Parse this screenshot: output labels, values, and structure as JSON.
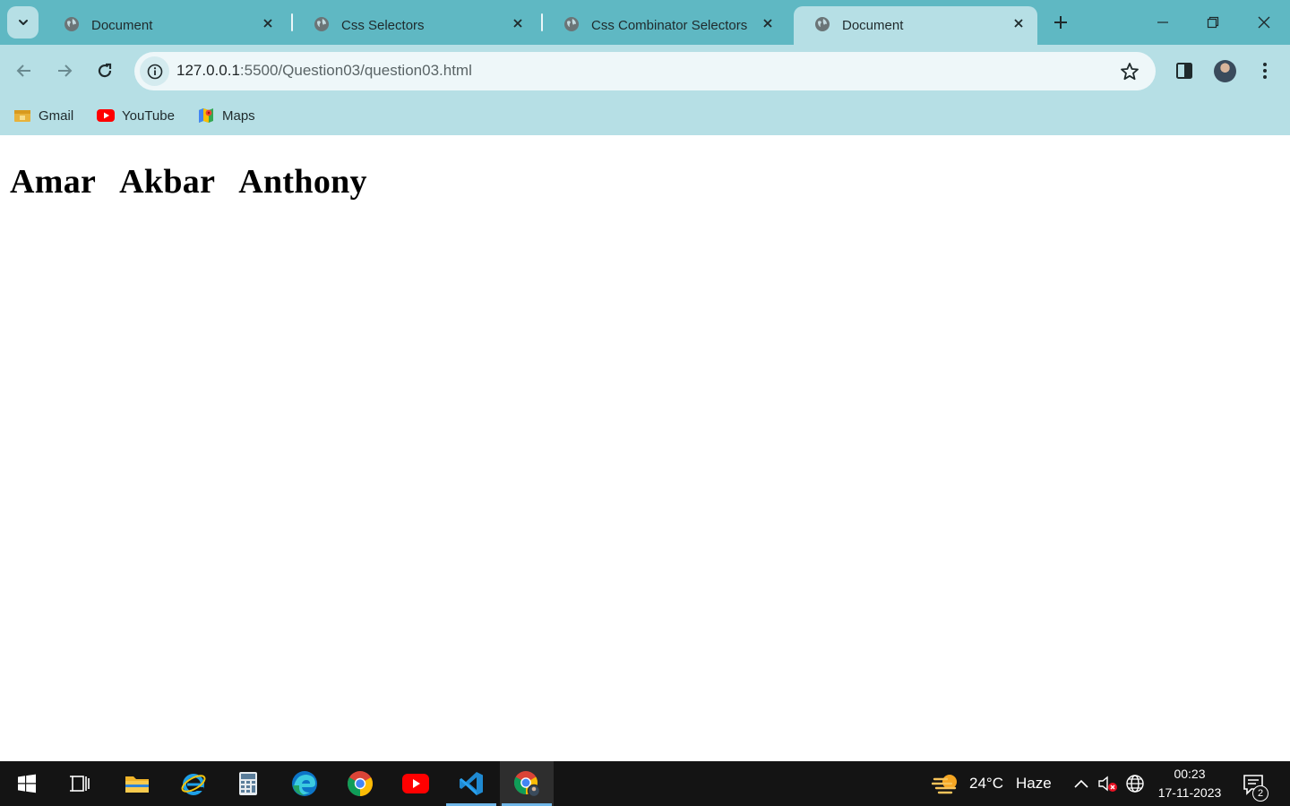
{
  "tabs": [
    {
      "title": "Document",
      "active": false
    },
    {
      "title": "Css Selectors",
      "active": false
    },
    {
      "title": "Css Combinator Selectors",
      "active": false
    },
    {
      "title": "Document",
      "active": true
    }
  ],
  "address_bar": {
    "url_host": "127.0.0.1",
    "url_rest": ":5500/Question03/question03.html"
  },
  "bookmarks": [
    {
      "label": "Gmail",
      "icon": "gmail-icon"
    },
    {
      "label": "YouTube",
      "icon": "youtube-icon"
    },
    {
      "label": "Maps",
      "icon": "maps-icon"
    }
  ],
  "page": {
    "headings": [
      "Amar",
      "Akbar",
      "Anthony"
    ]
  },
  "taskbar": {
    "apps": [
      "start-icon",
      "task-view-icon",
      "file-explorer-icon",
      "internet-explorer-icon",
      "calculator-icon",
      "edge-icon",
      "chrome-icon",
      "youtube-app-icon",
      "vscode-icon",
      "chrome-profile-icon"
    ],
    "weather_temp": "24°C",
    "weather_desc": "Haze",
    "time": "00:23",
    "date": "17-11-2023",
    "notification_count": "2"
  },
  "colors": {
    "tabstrip": "#5fb8c3",
    "toolbar": "#b6dfe5",
    "taskbar": "#141414"
  }
}
